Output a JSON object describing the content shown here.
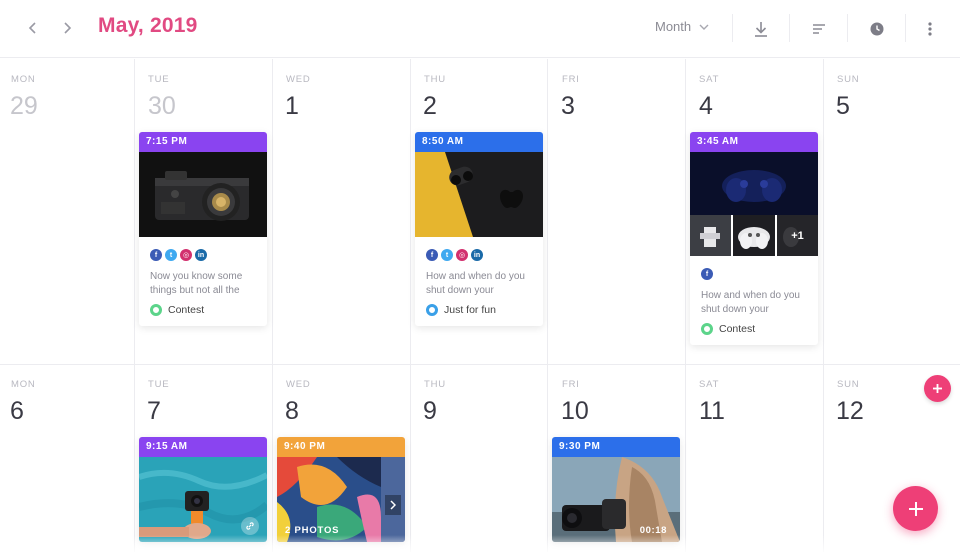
{
  "header": {
    "title": "May, 2019",
    "view_label": "Month",
    "icons": [
      "chevron-left-icon",
      "chevron-right-icon",
      "download-icon",
      "filter-icon",
      "clock-icon",
      "more-vertical-icon"
    ]
  },
  "weeks": [
    {
      "days": [
        {
          "dow": "MON",
          "date": "29"
        },
        {
          "dow": "TUE",
          "date": "30"
        },
        {
          "dow": "WED",
          "date": "1"
        },
        {
          "dow": "THU",
          "date": "2"
        },
        {
          "dow": "FRI",
          "date": "3"
        },
        {
          "dow": "SAT",
          "date": "4"
        },
        {
          "dow": "SUN",
          "date": "5"
        }
      ]
    },
    {
      "days": [
        {
          "dow": "MON",
          "date": "6"
        },
        {
          "dow": "TUE",
          "date": "7"
        },
        {
          "dow": "WED",
          "date": "8"
        },
        {
          "dow": "THU",
          "date": "9"
        },
        {
          "dow": "FRI",
          "date": "10"
        },
        {
          "dow": "SAT",
          "date": "11"
        },
        {
          "dow": "SUN",
          "date": "12"
        }
      ]
    }
  ],
  "posts": [
    {
      "time": "7:15 PM",
      "color": "#8a44f0",
      "networks": [
        "f",
        "t",
        "ig",
        "in"
      ],
      "text": "Now you know some things but not all the",
      "tag": "Contest",
      "tag_color": "#5cd48a",
      "image": "camera"
    },
    {
      "time": "8:50 AM",
      "color": "#2c6fea",
      "networks": [
        "f",
        "t",
        "ig",
        "in"
      ],
      "text": "How and when do you shut down your",
      "tag": "Just for fun",
      "tag_color": "#3aa0e8",
      "image": "phone"
    },
    {
      "time": "3:45 AM",
      "color": "#8a44f0",
      "networks": [
        "f"
      ],
      "text": "How and when do you shut down your",
      "tag": "Contest",
      "tag_color": "#5cd48a",
      "image": "gamepad",
      "extra_count": "+1"
    },
    {
      "time": "9:15 AM",
      "color": "#8a44f0",
      "image": "underwater"
    },
    {
      "time": "9:40 PM",
      "color": "#f2a33a",
      "image": "abstract",
      "badge": "2 PHOTOS"
    },
    {
      "time": "9:30 PM",
      "color": "#2c6fea",
      "image": "photographer",
      "badge": "00:18"
    }
  ],
  "colors": {
    "accent": "#ee3f77",
    "title": "#e14a82"
  }
}
